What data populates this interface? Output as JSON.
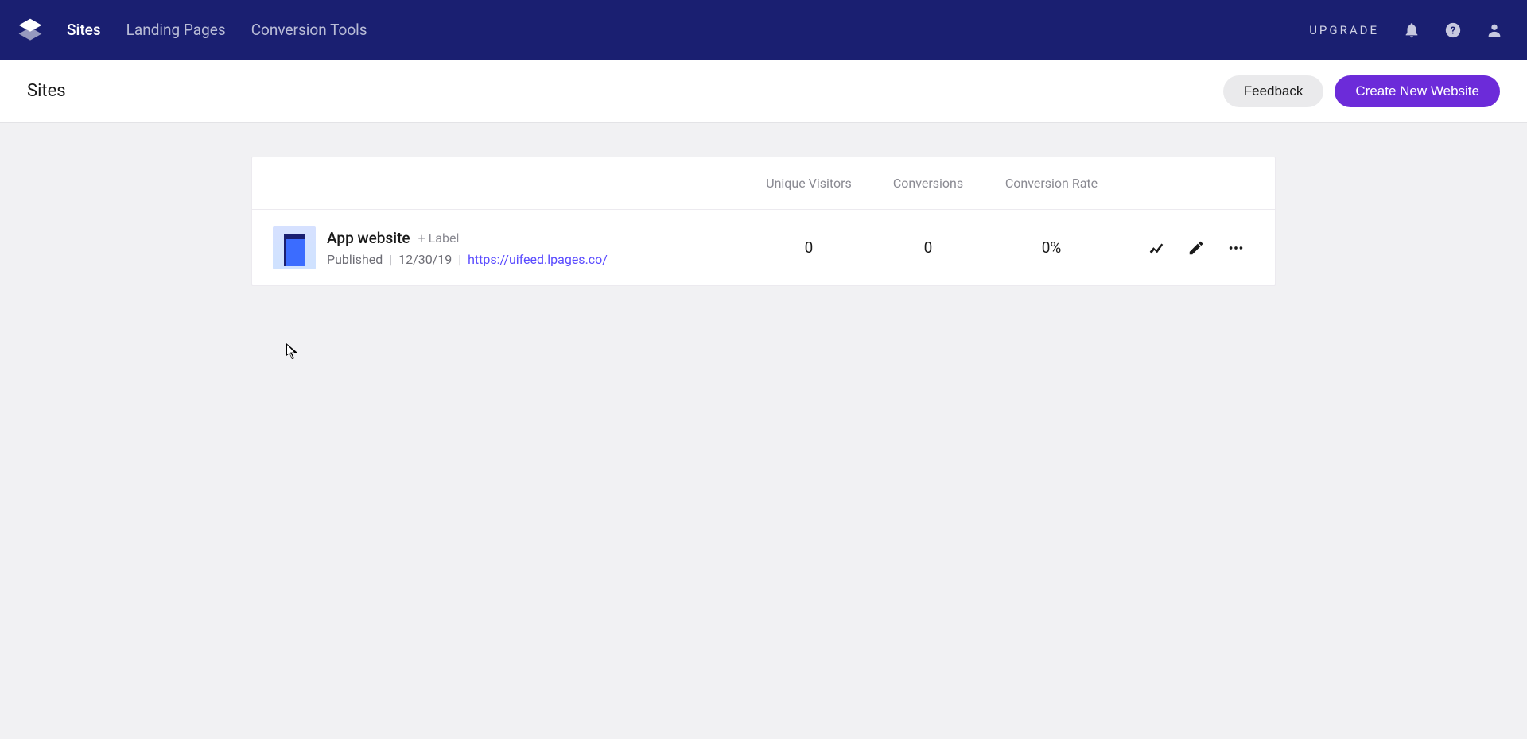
{
  "nav": {
    "items": [
      {
        "label": "Sites",
        "active": true
      },
      {
        "label": "Landing Pages",
        "active": false
      },
      {
        "label": "Conversion Tools",
        "active": false
      }
    ],
    "upgrade": "UPGRADE"
  },
  "subheader": {
    "title": "Sites",
    "feedback": "Feedback",
    "create": "Create New Website"
  },
  "table": {
    "columns": {
      "visitors": "Unique Visitors",
      "conversions": "Conversions",
      "rate": "Conversion Rate"
    },
    "rows": [
      {
        "title": "App website",
        "add_label_text": "+ Label",
        "status": "Published",
        "date": "12/30/19",
        "url": "https://uifeed.lpages.co/",
        "visitors": "0",
        "conversions": "0",
        "rate": "0%"
      }
    ]
  },
  "colors": {
    "navbar": "#1a1f71",
    "primary": "#6c2bd9",
    "link": "#5a4bff"
  }
}
